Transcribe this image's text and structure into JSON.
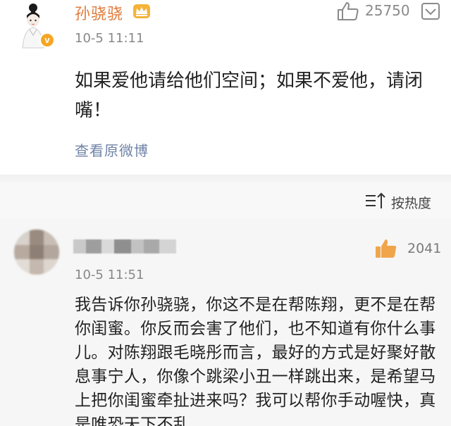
{
  "top_comment": {
    "username": "孙骁骁",
    "timestamp": "10-5 11:11",
    "like_count": "25750",
    "content": "如果爱他请给他们空间；如果不爱他，请闭嘴！",
    "view_original_label": "查看原微博",
    "verified_badge": "v",
    "icons": [
      "avatar",
      "crown-icon",
      "thumbs-up-icon",
      "more-icon"
    ]
  },
  "sort_bar": {
    "label": "按热度",
    "icon": "sort-icon"
  },
  "second_comment": {
    "timestamp": "10-5 11:51",
    "like_count": "2041",
    "content": "我告诉你孙骁骁，你这不是在帮陈翔，更不是在帮你闺蜜。你反而会害了他们，也不知道有你什么事儿。对陈翔跟毛晓彤而言，最好的方式是好聚好散息事宁人，你像个跳梁小丑一样跳出来，是希望马上把你闺蜜牵扯进来吗？我可以帮你手动喔快，真是唯恐天下不乱",
    "avatar_blurred": true,
    "username_blurred": true
  },
  "colors": {
    "username_orange": "#e07b3a",
    "link_blue": "#6f83a6",
    "like_orange": "#f0a54a",
    "muted_gray": "#888888"
  }
}
